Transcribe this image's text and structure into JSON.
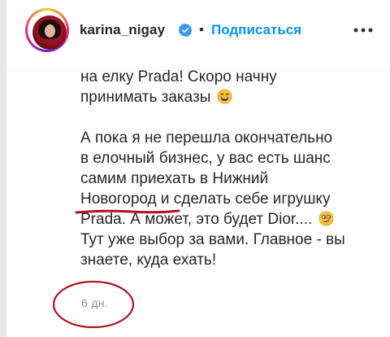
{
  "header": {
    "username": "karina_nigay",
    "separator": "•",
    "follow_label": "Подписаться",
    "more_icon": "more-horizontal-icon",
    "verified_icon": "verified-badge-icon"
  },
  "caption": {
    "lines": [
      "на елку Prada! Скоро начну",
      "принимать заказы",
      "",
      "А пока я не перешла окончательно",
      "в елочный бизнес, у вас есть шанс",
      "самим приехать в Нижний",
      "Новогород и сделать себе игрушку",
      "Prada. А может, это будет Dior....",
      "Тут уже выбор за вами. Главное - вы",
      "знаете, куда ехать!"
    ]
  },
  "timestamp": "6 дн.",
  "colors": {
    "accent": "#0095f6",
    "annotation": "#b3121e",
    "muted": "#8e8e8e",
    "text": "#262626"
  }
}
